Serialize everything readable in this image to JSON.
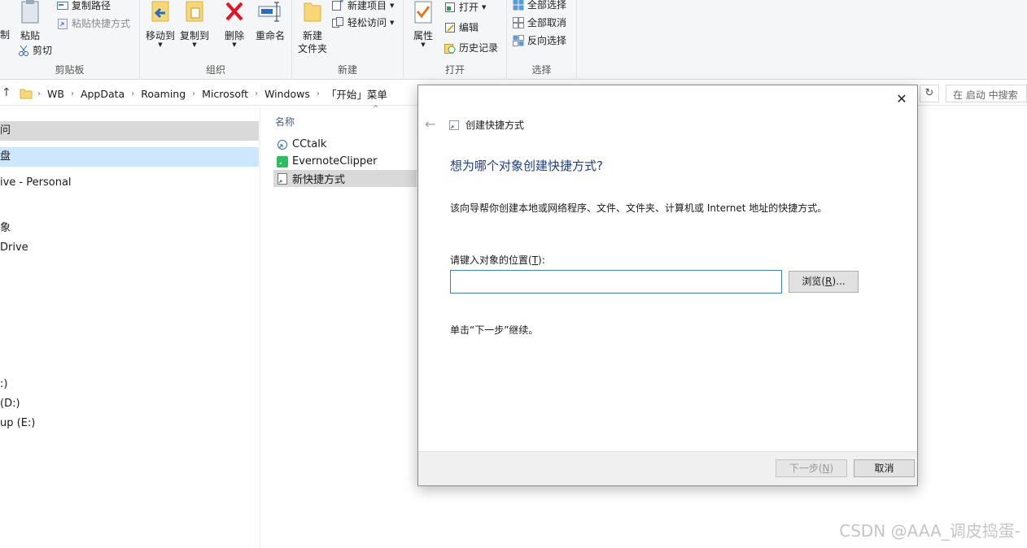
{
  "ribbon": {
    "clipboard": {
      "label": "剪贴板",
      "cut_partial": "制",
      "paste": "粘贴",
      "copy_path": "复制路径",
      "paste_shortcut": "粘贴快捷方式",
      "cut": "剪切"
    },
    "organize": {
      "label": "组织",
      "move_to": "移动到",
      "copy_to": "复制到",
      "delete": "删除",
      "rename": "重命名"
    },
    "new": {
      "label": "新建",
      "new_folder_line1": "新建",
      "new_folder_line2": "文件夹",
      "new_item": "新建项目",
      "easy_access": "轻松访问"
    },
    "open": {
      "label": "打开",
      "properties": "属性",
      "open": "打开",
      "edit": "编辑",
      "history": "历史记录"
    },
    "select": {
      "label": "选择",
      "select_all": "全部选择",
      "select_none": "全部取消",
      "invert": "反向选择"
    }
  },
  "address": {
    "crumbs": [
      "WB",
      "AppData",
      "Roaming",
      "Microsoft",
      "Windows",
      "「开始」菜单"
    ],
    "search_placeholder": "在 启动 中搜索"
  },
  "nav": {
    "items": [
      "问",
      "盘",
      "ive - Personal",
      "象",
      " Drive",
      ":)",
      " (D:)",
      "up (E:)"
    ]
  },
  "files": {
    "column_name": "名称",
    "items": [
      "CCtalk",
      "EvernoteClipper",
      "新快捷方式"
    ]
  },
  "dialog": {
    "title": "创建快捷方式",
    "heading": "想为哪个对象创建快捷方式?",
    "description": "该向导帮你创建本地或网络程序、文件、文件夹、计算机或 Internet 地址的快捷方式。",
    "input_label_prefix": "请键入对象的位置(",
    "input_label_key": "T",
    "input_label_suffix": "):",
    "input_value": "",
    "browse_prefix": "浏览(",
    "browse_key": "R",
    "browse_suffix": ")...",
    "hint": "单击“下一步”继续。",
    "next_prefix": "下一步(",
    "next_key": "N",
    "next_suffix": ")",
    "cancel": "取消"
  },
  "watermark": "CSDN @AAA_调皮捣蛋-",
  "colors": {
    "heading_blue": "#1f3c88",
    "input_border": "#3b7fc4",
    "delete_red": "#e81123",
    "folder_yellow": "#f8d775"
  }
}
